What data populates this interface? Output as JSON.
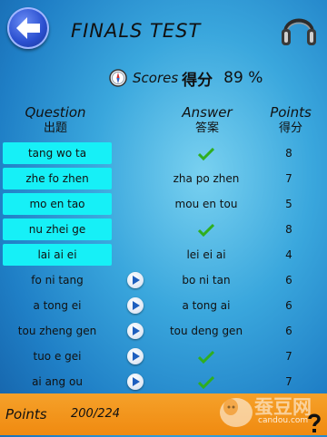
{
  "header": {
    "title": "FINALS TEST"
  },
  "score": {
    "label": "Scores",
    "label_cn": "得分",
    "value": "89 %"
  },
  "columns": {
    "question_en": "Question",
    "question_zh": "出题",
    "answer_en": "Answer",
    "answer_zh": "答案",
    "points_en": "Points",
    "points_zh": "得分"
  },
  "rows": [
    {
      "question": "tang wo ta",
      "answer": "",
      "correct": true,
      "points": "8",
      "highlight": true,
      "play": false
    },
    {
      "question": "zhe fo zhen",
      "answer": "zha po zhen",
      "correct": false,
      "points": "7",
      "highlight": true,
      "play": false
    },
    {
      "question": "mo en tao",
      "answer": "mou en tou",
      "correct": false,
      "points": "5",
      "highlight": true,
      "play": false
    },
    {
      "question": "nu zhei ge",
      "answer": "",
      "correct": true,
      "points": "8",
      "highlight": true,
      "play": false
    },
    {
      "question": "lai ai ei",
      "answer": "lei ei ai",
      "correct": false,
      "points": "4",
      "highlight": true,
      "play": false
    },
    {
      "question": "fo ni tang",
      "answer": "bo ni tan",
      "correct": false,
      "points": "6",
      "highlight": false,
      "play": true
    },
    {
      "question": "a tong ei",
      "answer": "a tong ai",
      "correct": false,
      "points": "6",
      "highlight": false,
      "play": true
    },
    {
      "question": "tou zheng gen",
      "answer": "tou deng gen",
      "correct": false,
      "points": "6",
      "highlight": false,
      "play": true
    },
    {
      "question": "tuo e gei",
      "answer": "",
      "correct": true,
      "points": "7",
      "highlight": false,
      "play": true
    },
    {
      "question": "ai ang ou",
      "answer": "",
      "correct": true,
      "points": "7",
      "highlight": false,
      "play": true
    }
  ],
  "footer": {
    "label": "Points",
    "value": "200/224"
  },
  "watermark": {
    "brand": "蚕豆网",
    "domain": "candou.com"
  },
  "colors": {
    "highlight": "#16f0f7",
    "footer": "#f08a10",
    "check": "#2fae1f"
  }
}
